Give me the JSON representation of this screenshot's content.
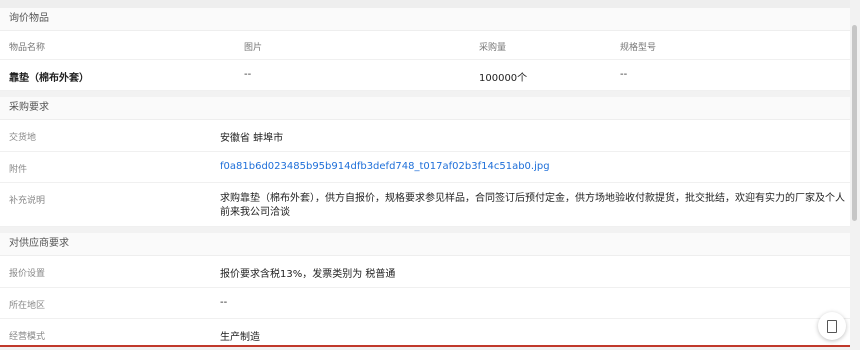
{
  "inquiry_items": {
    "title": "询价物品",
    "headers": [
      "物品名称",
      "图片",
      "采购量",
      "规格型号"
    ],
    "row": {
      "name": "靠垫（棉布外套）",
      "image": "--",
      "quantity": "100000个",
      "spec": "--"
    }
  },
  "purchase_requirements": {
    "title": "采购要求",
    "delivery_label": "交货地",
    "delivery_value": "安徽省 蚌埠市",
    "attachment_label": "附件",
    "attachment_value": "f0a81b6d023485b95b914dfb3defd748_t017af02b3f14c51ab0.jpg",
    "notes_label": "补充说明",
    "notes_value": "求购靠垫（棉布外套），供方自报价，规格要求参见样品，合同签订后预付定金，供方场地验收付款提货，批交批结，欢迎有实力的厂家及个人前来我公司洽谈"
  },
  "supplier_requirements": {
    "title": "对供应商要求",
    "quote_label": "报价设置",
    "quote_value": "报价要求含税13%，发票类别为 税普通",
    "region_label": "所在地区",
    "region_value": "--",
    "mode_label": "经营模式",
    "mode_value": "生产制造"
  },
  "icons": {
    "fab": "document-icon"
  }
}
